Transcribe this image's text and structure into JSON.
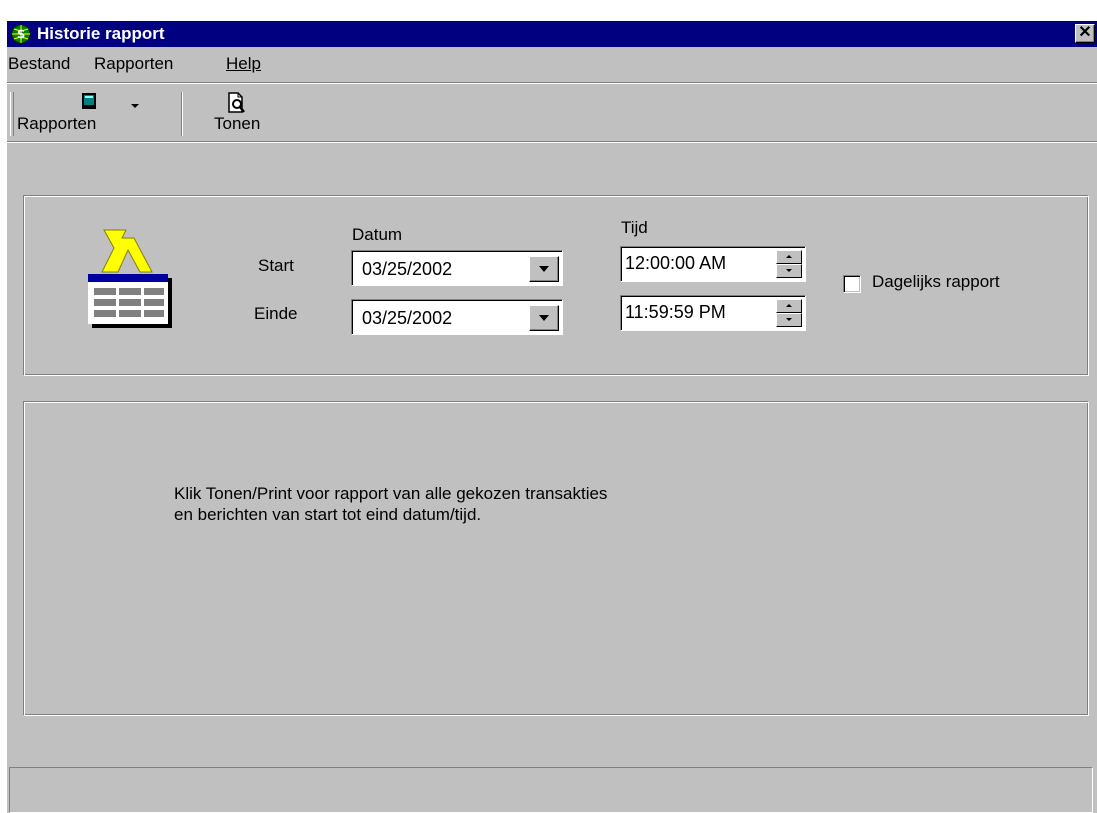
{
  "window": {
    "title": "Historie rapport",
    "close_label": "✕"
  },
  "menu": {
    "items": [
      {
        "label": "Bestand"
      },
      {
        "label": "Rapporten"
      },
      {
        "label": "Help"
      }
    ]
  },
  "toolbar": {
    "rapporten_label": "Rapporten",
    "tonen_label": "Tonen"
  },
  "form": {
    "datum_header": "Datum",
    "tijd_header": "Tijd",
    "start_label": "Start",
    "einde_label": "Einde",
    "start_date": "03/25/2002",
    "end_date": "03/25/2002",
    "start_time": "12:00:00 AM",
    "end_time": "11:59:59 PM",
    "daily_report_label": "Dagelijks rapport",
    "daily_report_checked": false
  },
  "info": {
    "line1": "Klik Tonen/Print voor rapport van alle gekozen transakties",
    "line2": "en berichten van start tot eind datum/tijd."
  },
  "colors": {
    "titlebar": "#000080",
    "face": "#c0c0c0",
    "icon_yellow": "#ffff00",
    "icon_blue": "#0000a0"
  },
  "statusbar": {
    "text": ""
  }
}
